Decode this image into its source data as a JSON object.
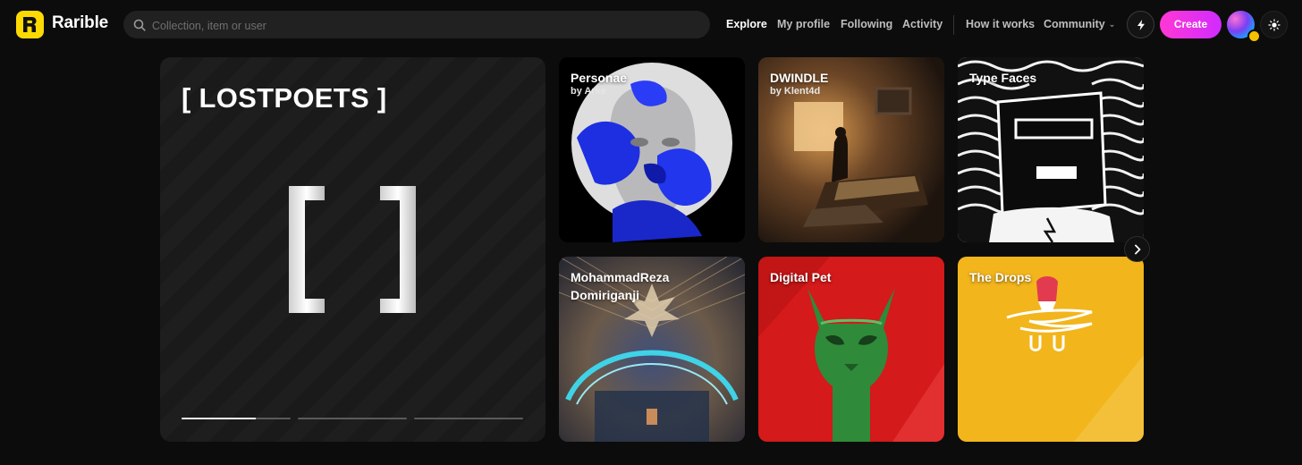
{
  "header": {
    "brand": "Rarible",
    "search_placeholder": "Collection, item or user",
    "nav": {
      "explore": "Explore",
      "my_profile": "My profile",
      "following": "Following",
      "activity": "Activity",
      "how_it_works": "How it works",
      "community": "Community"
    },
    "create_label": "Create",
    "icons": {
      "lightning": "lightning-icon",
      "theme": "sun-icon",
      "search": "search-icon"
    },
    "accent": "#feda03",
    "create_gradient": [
      "#ff38d4",
      "#d12bff"
    ]
  },
  "hero": {
    "title": "[ LOSTPOETS ]",
    "progress": [
      0.68,
      0,
      0
    ]
  },
  "collections": [
    {
      "title": "Personae",
      "byline": "by Arke"
    },
    {
      "title": "DWINDLE",
      "byline": "by Klent4d"
    },
    {
      "title": "Type Faces",
      "byline": ""
    },
    {
      "title": "MohammadReza Domiriganji",
      "byline": ""
    },
    {
      "title": "Digital Pet",
      "byline": ""
    },
    {
      "title": "The Drops",
      "byline": ""
    }
  ],
  "colors": {
    "digital_pet_bg": "#d41a1a",
    "drops_bg": "#f2b51c"
  }
}
